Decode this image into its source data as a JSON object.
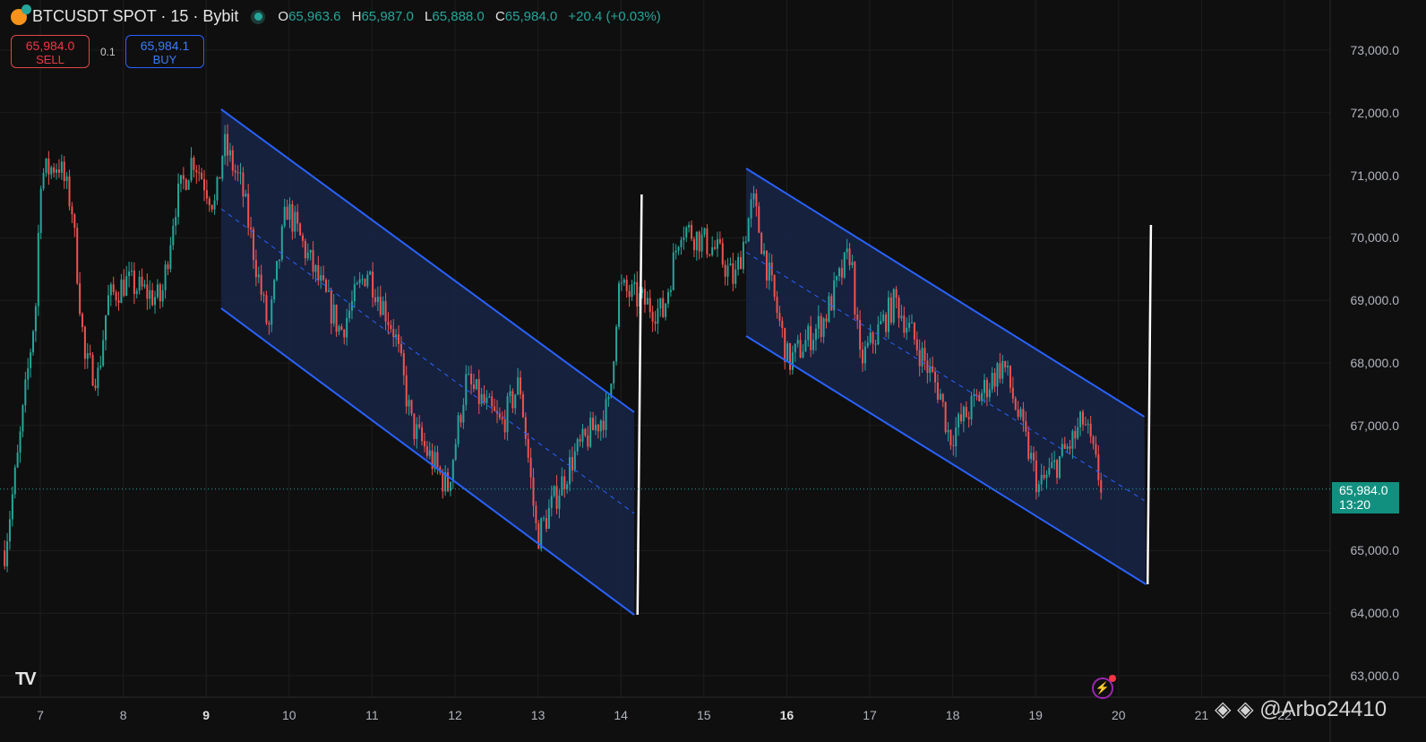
{
  "header": {
    "symbol": "BTCUSDT SPOT · 15 · Bybit",
    "o_label": "O",
    "o": "65,963.6",
    "h_label": "H",
    "h": "65,987.0",
    "l_label": "L",
    "l": "65,888.0",
    "c_label": "C",
    "c": "65,984.0",
    "change": "+20.4 (+0.03%)"
  },
  "trade": {
    "sell_price": "65,984.0",
    "sell_label": "SELL",
    "qty": "0.1",
    "buy_price": "65,984.1",
    "buy_label": "BUY"
  },
  "current": {
    "price": "65,984.0",
    "countdown": "13:20"
  },
  "watermark": "◈ ◈ @Arbo24410",
  "colors": {
    "up": "#26a69a",
    "down": "#ef5350",
    "channel": "#2962ff",
    "channel_fill": "#172447",
    "vline": "#ffffff"
  },
  "chart_data": {
    "type": "candlestick",
    "title": "BTCUSDT SPOT · 15 · Bybit",
    "ylim": [
      62600,
      73500
    ],
    "xlim": [
      6.57,
      22.6
    ],
    "y_ticks": [
      {
        "v": 73000,
        "label": "73,000.0"
      },
      {
        "v": 72000,
        "label": "72,000.0"
      },
      {
        "v": 71000,
        "label": "71,000.0"
      },
      {
        "v": 70000,
        "label": "70,000.0"
      },
      {
        "v": 69000,
        "label": "69,000.0"
      },
      {
        "v": 68000,
        "label": "68,000.0"
      },
      {
        "v": 67000,
        "label": "67,000.0"
      },
      {
        "v": 65000,
        "label": "65,000.0"
      },
      {
        "v": 64000,
        "label": "64,000.0"
      },
      {
        "v": 63000,
        "label": "63,000.0"
      }
    ],
    "x_ticks": [
      {
        "v": 7,
        "label": "7"
      },
      {
        "v": 8,
        "label": "8"
      },
      {
        "v": 9,
        "label": "9",
        "bold": true
      },
      {
        "v": 10,
        "label": "10"
      },
      {
        "v": 11,
        "label": "11"
      },
      {
        "v": 12,
        "label": "12"
      },
      {
        "v": 13,
        "label": "13"
      },
      {
        "v": 14,
        "label": "14"
      },
      {
        "v": 15,
        "label": "15"
      },
      {
        "v": 16,
        "label": "16",
        "bold": true
      },
      {
        "v": 17,
        "label": "17"
      },
      {
        "v": 18,
        "label": "18"
      },
      {
        "v": 19,
        "label": "19"
      },
      {
        "v": 20,
        "label": "20"
      },
      {
        "v": 21,
        "label": "21"
      },
      {
        "v": 22,
        "label": "22"
      }
    ],
    "price_path": [
      [
        6.57,
        65000
      ],
      [
        6.73,
        66500
      ],
      [
        6.95,
        69000
      ],
      [
        7.0,
        71000
      ],
      [
        7.22,
        71200
      ],
      [
        7.38,
        70500
      ],
      [
        7.54,
        68000
      ],
      [
        7.7,
        67800
      ],
      [
        7.81,
        69000
      ],
      [
        8.03,
        69300
      ],
      [
        8.46,
        69000
      ],
      [
        8.62,
        70500
      ],
      [
        8.84,
        71300
      ],
      [
        9.11,
        70500
      ],
      [
        9.21,
        71500
      ],
      [
        9.43,
        70800
      ],
      [
        9.75,
        68500
      ],
      [
        9.97,
        70500
      ],
      [
        10.29,
        69500
      ],
      [
        10.62,
        68500
      ],
      [
        10.94,
        69500
      ],
      [
        11.27,
        68500
      ],
      [
        11.48,
        67000
      ],
      [
        11.91,
        66000
      ],
      [
        12.13,
        67700
      ],
      [
        12.56,
        67000
      ],
      [
        12.78,
        67700
      ],
      [
        12.99,
        65200
      ],
      [
        13.43,
        66500
      ],
      [
        13.86,
        67300
      ],
      [
        13.97,
        69200
      ],
      [
        14.51,
        68800
      ],
      [
        14.72,
        70200
      ],
      [
        15.15,
        69800
      ],
      [
        15.37,
        69300
      ],
      [
        15.59,
        70600
      ],
      [
        15.8,
        69300
      ],
      [
        16.02,
        68000
      ],
      [
        16.45,
        68700
      ],
      [
        16.77,
        69800
      ],
      [
        16.88,
        68000
      ],
      [
        17.31,
        69000
      ],
      [
        17.85,
        67500
      ],
      [
        17.96,
        66800
      ],
      [
        18.61,
        68000
      ],
      [
        19.04,
        66000
      ],
      [
        19.47,
        66800
      ],
      [
        19.58,
        67100
      ],
      [
        19.8,
        65984
      ]
    ],
    "current_price": 65984,
    "channels": [
      {
        "top": [
          [
            9.18,
            72055
          ],
          [
            14.16,
            67212
          ]
        ],
        "bottom": [
          [
            9.18,
            68874
          ],
          [
            14.16,
            63974
          ]
        ]
      },
      {
        "top": [
          [
            15.51,
            71109
          ],
          [
            20.31,
            67140
          ]
        ],
        "bottom": [
          [
            15.51,
            68430
          ],
          [
            20.33,
            64461
          ]
        ]
      }
    ],
    "vertical_lines": [
      [
        [
          14.25,
          70693
        ],
        [
          14.2,
          63974
        ]
      ],
      [
        [
          20.39,
          70206
        ],
        [
          20.35,
          64461
        ]
      ]
    ]
  }
}
